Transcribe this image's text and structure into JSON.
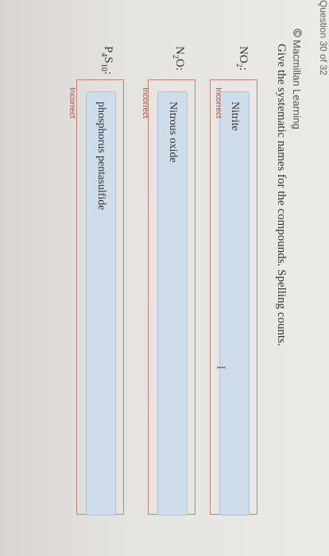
{
  "question_label": "Question 30 of 32",
  "brand": {
    "name": "Macmillan Learning",
    "icon": "copyright-circle-icon"
  },
  "instructions": "Give the systematic names for the compounds. Spelling counts.",
  "rows": [
    {
      "formula_base": "NO",
      "formula_sub": "2",
      "formula_tail": ":",
      "answer": "Nitrite",
      "status": "Incorrect"
    },
    {
      "formula_base": "N",
      "formula_sub": "2",
      "formula_tail": "O:",
      "answer": "Nitrous oxide",
      "status": "Incorrect"
    },
    {
      "formula_base": "P",
      "formula_sub": "4",
      "formula_mid": "S",
      "formula_sub2": "10",
      "formula_tail": ":",
      "answer": "phosphorus pentasulfide",
      "status": "Incorrect"
    }
  ],
  "colors": {
    "input_bg": "#cfdcea",
    "box_border": "#b9857a",
    "status_incorrect": "#b04a3a"
  },
  "cursor_glyph": "I"
}
